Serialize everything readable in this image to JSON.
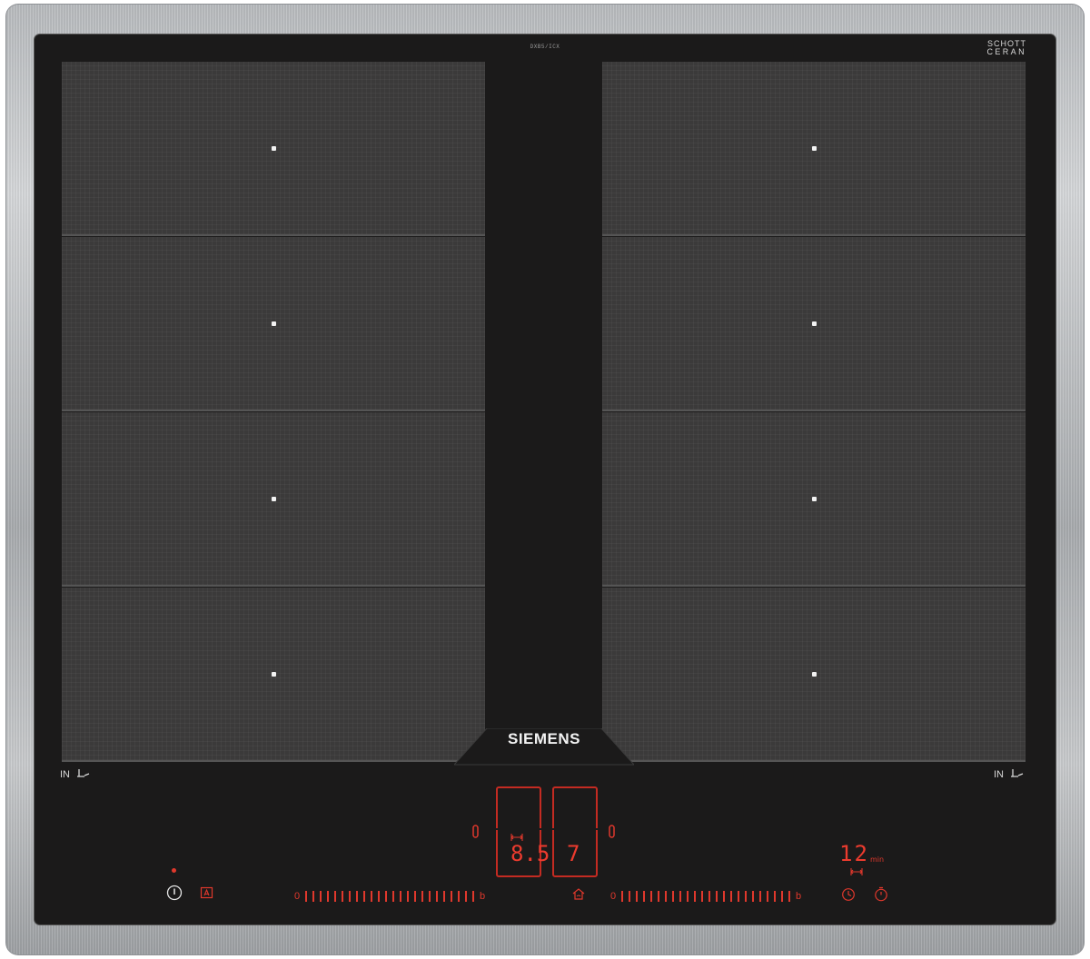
{
  "labels": {
    "top_center": "DXB5/ICX",
    "schott_line1": "SCHOTT",
    "schott_line2": "CERAN",
    "brand": "SIEMENS",
    "in_left": "IN",
    "in_right": "IN"
  },
  "displays": {
    "zone_left_value": "8.5",
    "zone_right_value": "7",
    "timer_value": "12",
    "timer_unit": "min"
  },
  "sliders": {
    "left": {
      "start": "0",
      "end": "b",
      "ticks": 24
    },
    "right": {
      "start": "0",
      "end": "b",
      "ticks": 24
    }
  },
  "cooking_zones": {
    "count": 8,
    "columns": 2,
    "rows": 4
  },
  "icons": [
    "power-icon",
    "child-lock-icon",
    "booster-icon-left",
    "booster-icon-right",
    "home-icon",
    "timer-clock-icon",
    "stopwatch-icon",
    "flex-zone-icon",
    "pan-icon"
  ],
  "colors": {
    "glass": "#1b1a1a",
    "zone": "#3b3a3a",
    "indicator_red": "#e0382c",
    "frame_steel": "#b9bcbf"
  }
}
